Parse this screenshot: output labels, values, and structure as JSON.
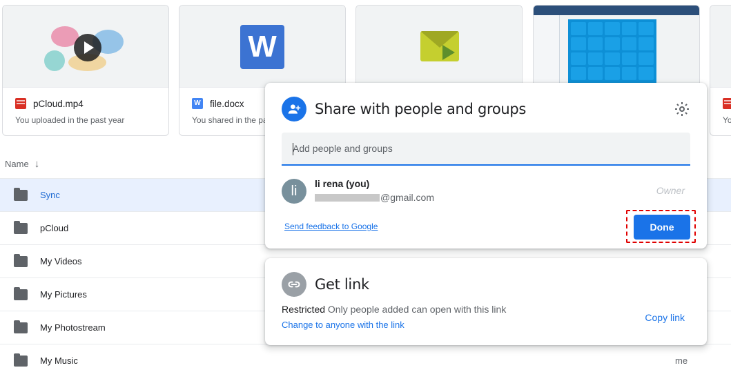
{
  "cards": [
    {
      "name": "pCloud.mp4",
      "subtitle": "You uploaded in the past year",
      "icon": "video-file-icon"
    },
    {
      "name": "file.docx",
      "subtitle": "You shared in the pa",
      "icon": "word-file-icon",
      "thumb_letter": "W",
      "icon_letter": "W"
    },
    {
      "name": "",
      "subtitle": "",
      "icon": "mail-file-icon"
    },
    {
      "name": "",
      "subtitle": "",
      "icon": "screenshot-file-icon"
    },
    {
      "name": "",
      "subtitle": "Yo",
      "icon": "video-file-icon"
    }
  ],
  "list": {
    "header": "Name",
    "rows": [
      {
        "name": "Sync",
        "selected": true,
        "owner": ""
      },
      {
        "name": "pCloud",
        "owner": ""
      },
      {
        "name": "My Videos",
        "owner": ""
      },
      {
        "name": "My Pictures",
        "owner": ""
      },
      {
        "name": "My Photostream",
        "owner": ""
      },
      {
        "name": "My Music",
        "owner": "me"
      }
    ]
  },
  "share_dialog": {
    "title": "Share with people and groups",
    "input_placeholder": "Add people and groups",
    "person": {
      "avatar_letter": "li",
      "name": "li rena (you)",
      "email_visible": "@gmail.com",
      "role": "Owner"
    },
    "feedback_link": "Send feedback to Google",
    "done_label": "Done"
  },
  "get_link": {
    "title": "Get link",
    "status_bold": "Restricted",
    "status_text": "Only people added can open with this link",
    "change_link": "Change to anyone with the link",
    "copy_link": "Copy link"
  },
  "colors": {
    "accent": "#1a73e8",
    "highlight": "#e00000",
    "selected_row": "#e8f0fe"
  }
}
